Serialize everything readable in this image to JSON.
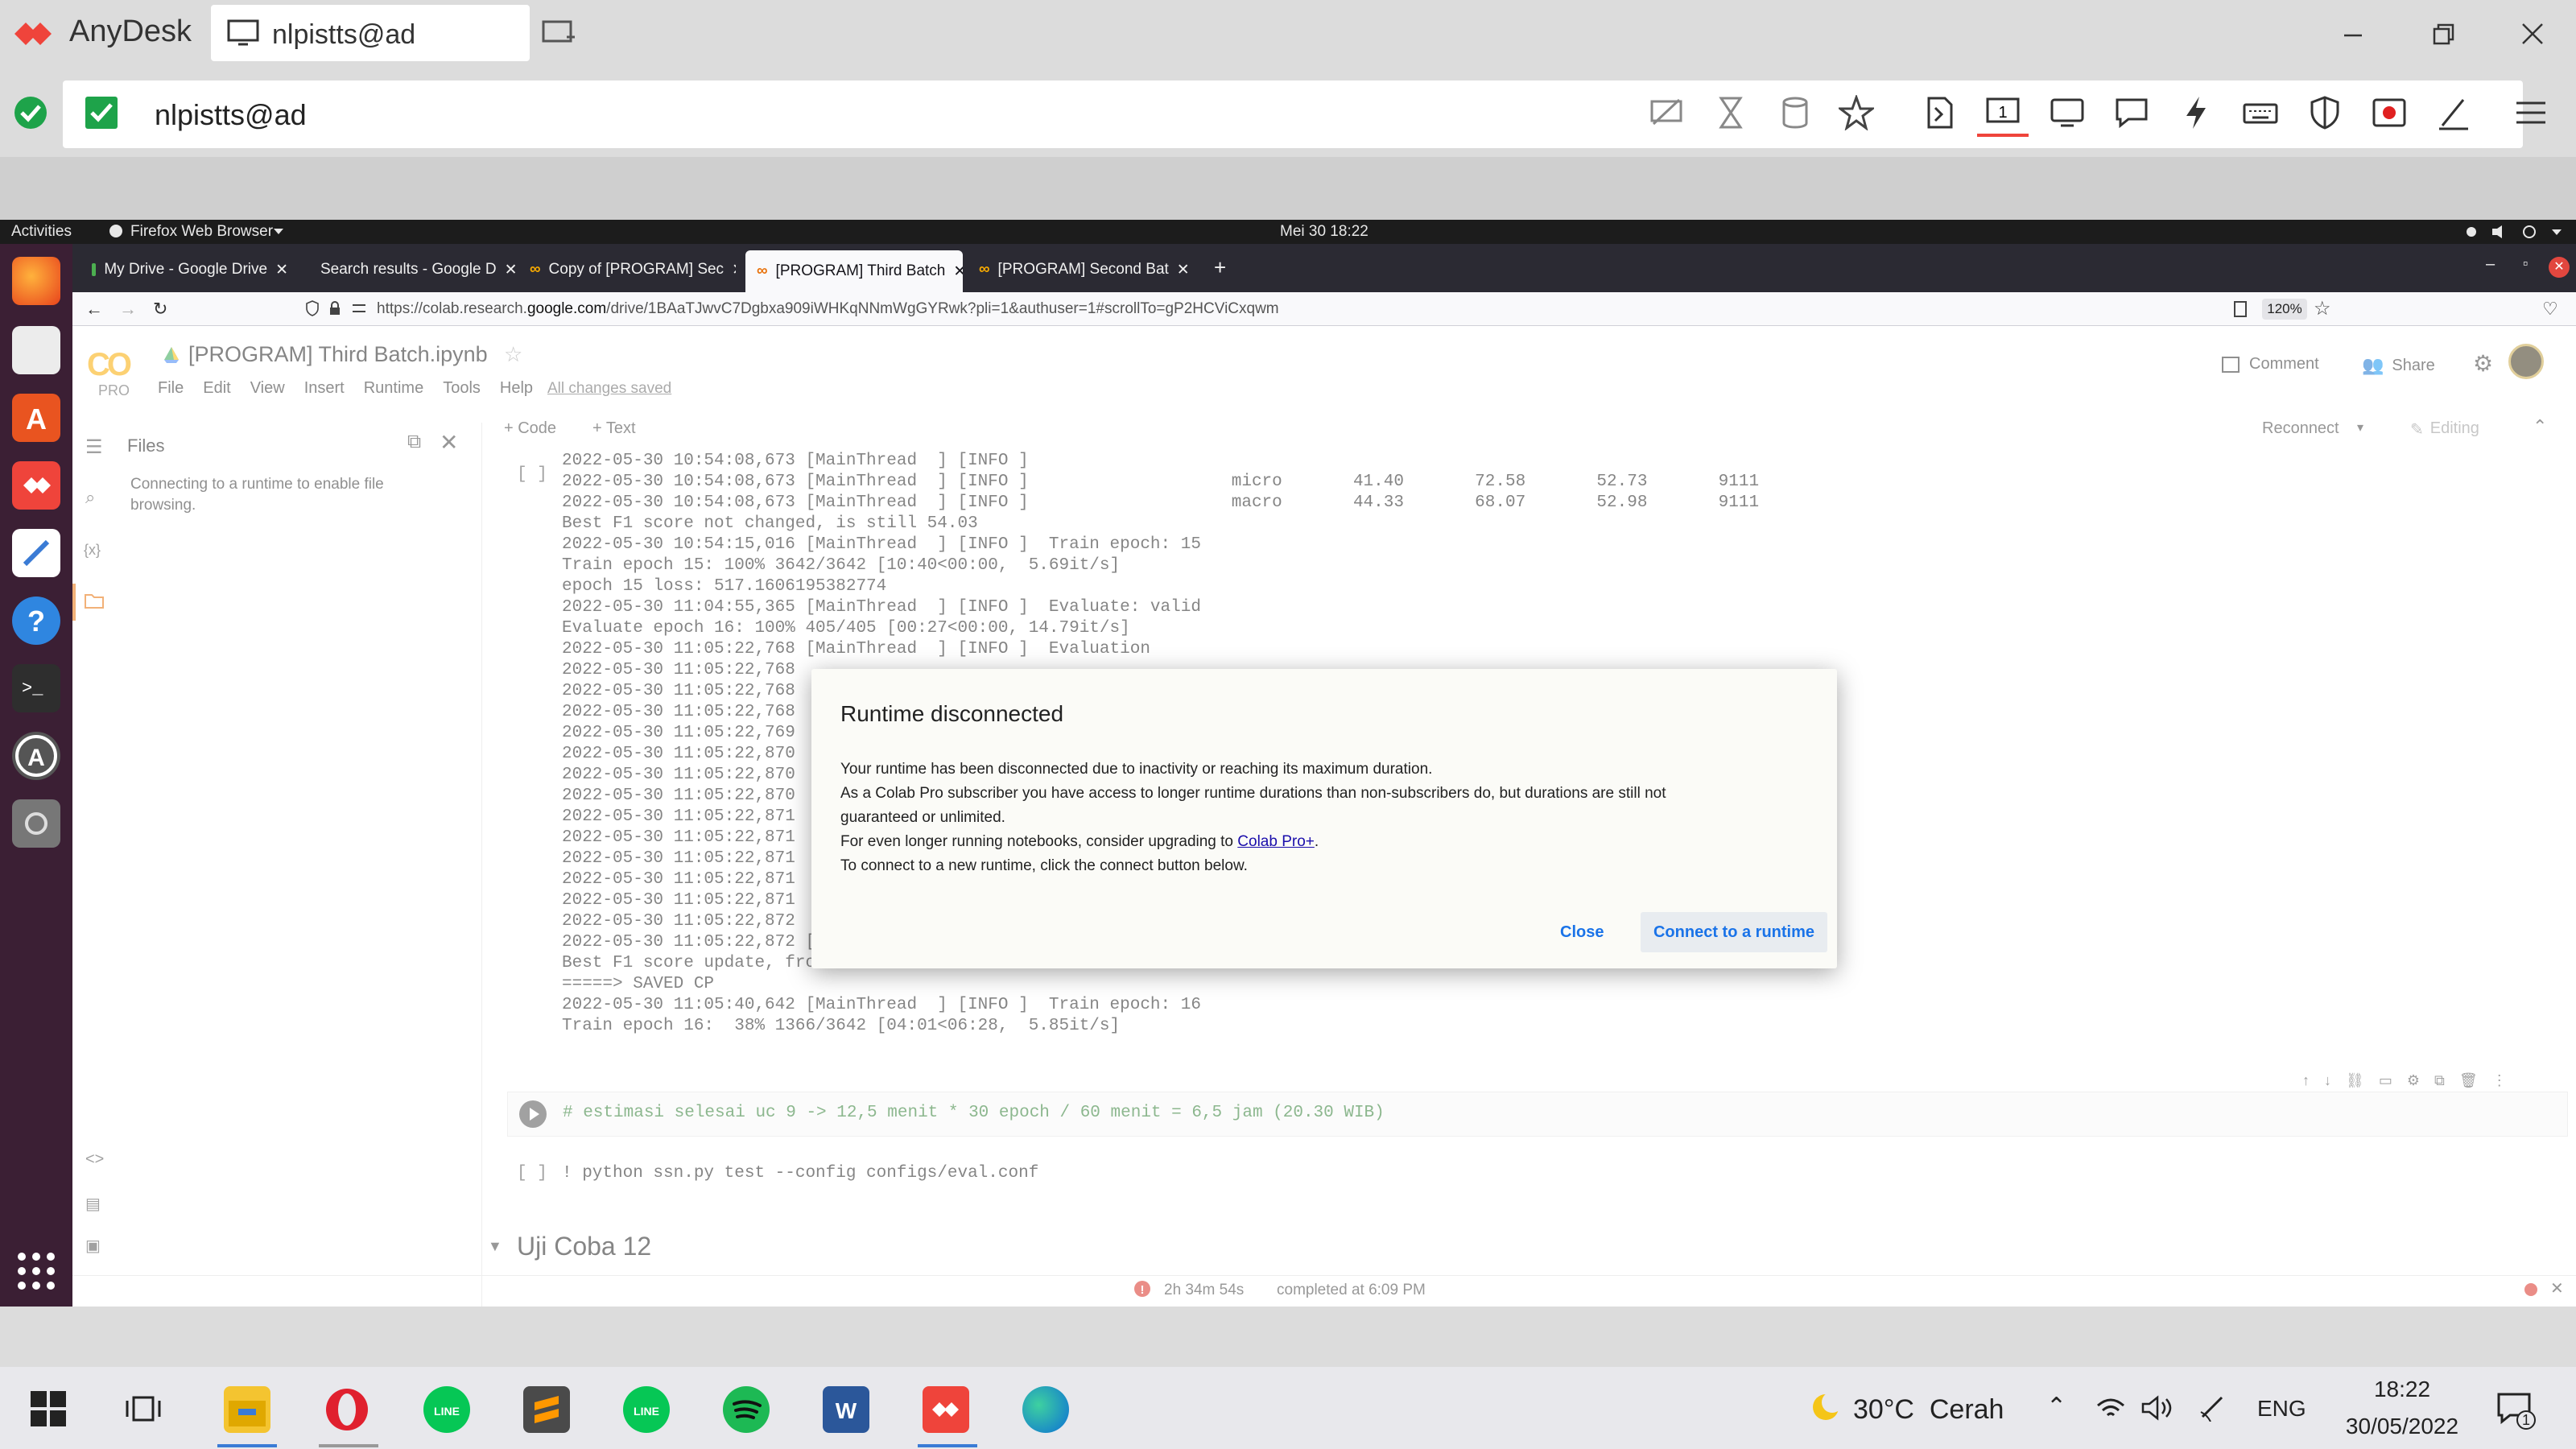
{
  "anydesk": {
    "app_name": "AnyDesk",
    "tab_label": "nlpistts@ad",
    "address": "nlpistts@ad",
    "colors": {
      "brand": "#ef443b",
      "ok": "#1ea34a"
    }
  },
  "gnome": {
    "activities": "Activities",
    "app": "Firefox Web Browser",
    "clock": "Mei 30  18:22"
  },
  "firefox": {
    "tabs": [
      {
        "label": "My Drive - Google Drive"
      },
      {
        "label": "Search results - Google D"
      },
      {
        "label": "Copy of [PROGRAM] Sec"
      },
      {
        "label": "[PROGRAM] Third Batch"
      },
      {
        "label": "[PROGRAM] Second Bat"
      }
    ],
    "url_prefix": "https://colab.research.",
    "url_domain": "google.com",
    "url_suffix": "/drive/1BAaTJwvC7Dgbxa909iWHKqNNmWgGYRwk?pli=1&authuser=1#scrollTo=gP2HCViCxqwm",
    "zoom": "120%"
  },
  "colab": {
    "logo": "CO",
    "pro": "PRO",
    "title": "[PROGRAM] Third Batch.ipynb",
    "menu": [
      "File",
      "Edit",
      "View",
      "Insert",
      "Runtime",
      "Tools",
      "Help"
    ],
    "saved": "All changes saved",
    "comment": "Comment",
    "share": "Share",
    "add_code": "+ Code",
    "add_text": "+ Text",
    "reconnect": "Reconnect",
    "editing": "Editing",
    "files_title": "Files",
    "files_msg_1": "Connecting to a runtime to enable file",
    "files_msg_2": "browsing.",
    "cell_bracket": "[ ]",
    "log_lines": [
      "2022-05-30 10:54:08,673 [MainThread  ] [INFO ]",
      "2022-05-30 10:54:08,673 [MainThread  ] [INFO ]                    micro       41.40       72.58       52.73       9111",
      "2022-05-30 10:54:08,673 [MainThread  ] [INFO ]                    macro       44.33       68.07       52.98       9111",
      "Best F1 score not changed, is still 54.03",
      "2022-05-30 10:54:15,016 [MainThread  ] [INFO ]  Train epoch: 15",
      "Train epoch 15: 100% 3642/3642 [10:40<00:00,  5.69it/s]",
      "epoch 15 loss: 517.1606195382774",
      "2022-05-30 11:04:55,365 [MainThread  ] [INFO ]  Evaluate: valid",
      "Evaluate epoch 16: 100% 405/405 [00:27<00:00, 14.79it/s]",
      "2022-05-30 11:05:22,768 [MainThread  ] [INFO ]  Evaluation",
      "2022-05-30 11:05:22,768",
      "2022-05-30 11:05:22,768",
      "2022-05-30 11:05:22,768                                                                                         ectly",
      "2022-05-30 11:05:22,769",
      "2022-05-30 11:05:22,870",
      "2022-05-30 11:05:22,870",
      "2022-05-30 11:05:22,870",
      "2022-05-30 11:05:22,871",
      "2022-05-30 11:05:22,871",
      "2022-05-30 11:05:22,871",
      "2022-05-30 11:05:22,871",
      "2022-05-30 11:05:22,871",
      "2022-05-30 11:05:22,872",
      "2022-05-30 11:05:22,872 [MainThread  ] [INFO ]                    macro",
      "Best F1 score update, from 54.03 to 56.45",
      "=====> SAVED CP",
      "2022-05-30 11:05:40,642 [MainThread  ] [INFO ]  Train epoch: 16",
      "Train epoch 16:  38% 1366/3642 [04:01<06:28,  5.85it/s]"
    ],
    "code_cell": "# estimasi selesai uc 9 -> 12,5 menit * 30 epoch / 60 menit = 6,5 jam (20.30 WIB)",
    "cmd_cell": "! python ssn.py test --config configs/eval.conf",
    "section": "Uji Coba 12",
    "status_time": "2h 34m 54s",
    "status_done": "completed at 6:09 PM"
  },
  "dialog": {
    "title": "Runtime disconnected",
    "line1": "Your runtime has been disconnected due to inactivity or reaching its maximum duration.",
    "line2": "As a Colab Pro subscriber you have access to longer runtime durations than non-subscribers do, but durations are still not",
    "line3": "guaranteed or unlimited.",
    "line4_pre": "For even longer running notebooks, consider upgrading to ",
    "line4_link": "Colab Pro+",
    "line4_post": ".",
    "line5": "To connect to a new runtime, click the connect button below.",
    "close": "Close",
    "connect": "Connect to a runtime"
  },
  "taskbar": {
    "weather": "30°C  Cerah",
    "lang": "ENG",
    "time": "18:22",
    "date": "30/05/2022",
    "notif": "1"
  }
}
